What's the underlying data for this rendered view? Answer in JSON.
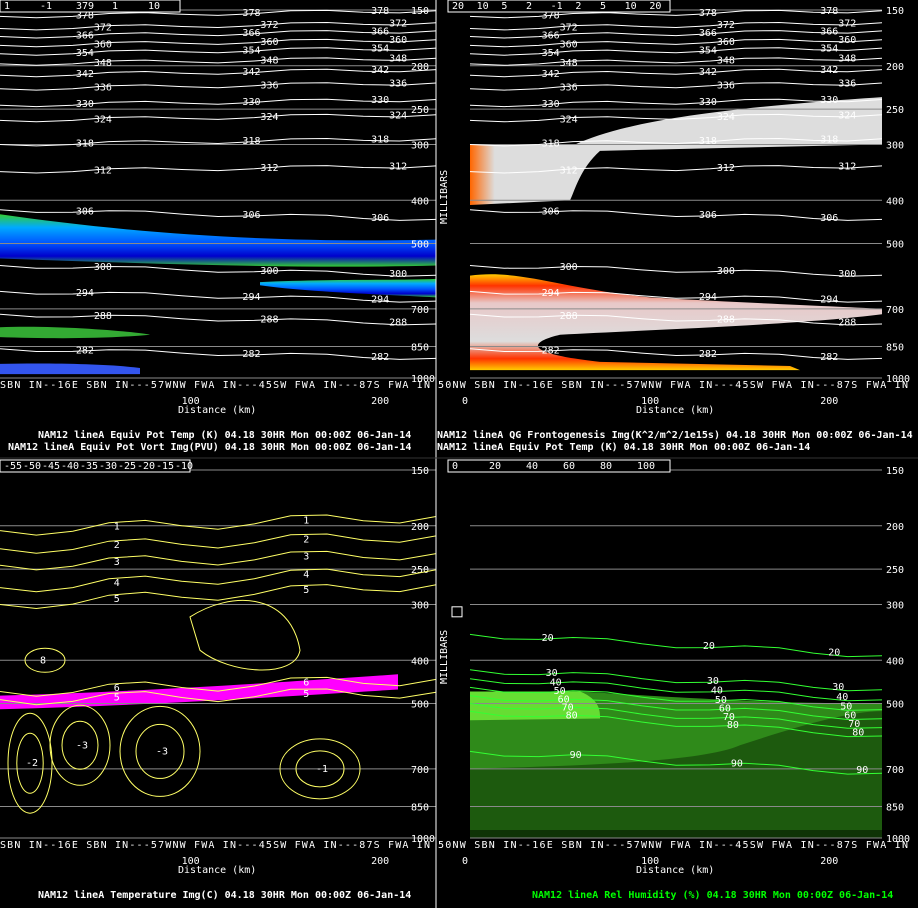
{
  "colors": {
    "background": "#000000",
    "grid": "#ffffff",
    "theta_contour": "#ffffff",
    "temperature_contour": "#ffff66",
    "rh_contour": "#33ff33",
    "pv_fill": [
      "#33cc33",
      "#00aaff",
      "#0055ff",
      "#0000cc"
    ],
    "frontogenesis_fill": [
      "#ffff00",
      "#ff9900",
      "#ff2200",
      "#cc0000",
      "#ffcccc",
      "#dddddd"
    ],
    "rh_fill": [
      "#66dd33",
      "#44aa22",
      "#227711",
      "#114400"
    ],
    "temp_highlight": "#ff00ff",
    "caption_white": "#ffffff",
    "caption_green": "#00ff00"
  },
  "panels": [
    {
      "id": "top-left",
      "legend": [
        "1",
        "-1",
        "379",
        "1",
        "10"
      ],
      "pressure_ticks": [
        "150",
        "200",
        "250",
        "300",
        "400",
        "500",
        "700",
        "850",
        "1000"
      ],
      "x_ticks": [
        "100",
        "200"
      ],
      "x_label": "Distance (km)",
      "stations": "SBN IN--16E SBN IN---57WNW FWA IN---45SW FWA IN---87S FWA IN",
      "captions": [
        {
          "text": "NAM12 lineA  Equiv Pot Temp (K)  04.18  30HR Mon 00:00Z 06-Jan-14",
          "color": "#ffffff"
        },
        {
          "text": "NAM12 lineA  Equiv Pot Vort Img(PVU)  04.18  30HR Mon 00:00Z 06-Jan-14",
          "color": "#ffffff"
        }
      ]
    },
    {
      "id": "top-right",
      "legend": [
        "20",
        "10",
        "5",
        "2",
        "-1",
        "2",
        "5",
        "10",
        "20"
      ],
      "y_label": "MILLIBARS",
      "pressure_ticks": [
        "150",
        "200",
        "250",
        "300",
        "400",
        "500",
        "700",
        "850",
        "1000"
      ],
      "x_ticks": [
        "0",
        "100",
        "200"
      ],
      "x_label": "Distance (km)",
      "stations": "50NW SBN IN--16E SBN IN---57WNW FWA IN---45SW FWA IN---87S FWA IN",
      "captions": [
        {
          "text": "NAM12 lineA  QG Frontogenesis Img(K^2/m^2/1e15s)  04.18  30HR Mon 00:00Z 06-Jan-14",
          "color": "#ffffff"
        },
        {
          "text": "NAM12 lineA  Equiv Pot Temp (K)  04.18  30HR Mon 00:00Z 06-Jan-14",
          "color": "#ffffff"
        }
      ]
    },
    {
      "id": "bottom-left",
      "legend": [
        "-55",
        "-50",
        "-45",
        "-40",
        "-35",
        "-30",
        "-25",
        "-20",
        "-15",
        "-10"
      ],
      "pressure_ticks": [
        "150",
        "200",
        "250",
        "300",
        "400",
        "500",
        "700",
        "850",
        "1000"
      ],
      "x_ticks": [
        "100",
        "200"
      ],
      "x_label": "Distance (km)",
      "stations": "SBN IN--16E SBN IN---57WNW FWA IN---45SW FWA IN---87S FWA IN",
      "captions": [
        {
          "text": "NAM12 lineA  Temperature Img(C)  04.18  30HR Mon 00:00Z 06-Jan-14",
          "color": "#ffffff"
        }
      ]
    },
    {
      "id": "bottom-right",
      "legend": [
        "0",
        "20",
        "40",
        "60",
        "80",
        "100"
      ],
      "y_label": "MILLIBARS",
      "pressure_ticks": [
        "150",
        "200",
        "250",
        "300",
        "400",
        "500",
        "700",
        "850",
        "1000"
      ],
      "x_ticks": [
        "0",
        "100",
        "200"
      ],
      "x_label": "Distance (km)",
      "stations": "50NW SBN IN--16E SBN IN---57WNW FWA IN---45SW FWA IN---87S FWA IN",
      "captions": [
        {
          "text": "NAM12 lineA  Rel Humidity (%)  04.18  30HR Mon 00:00Z 06-Jan-14",
          "color": "#00ff00"
        }
      ]
    }
  ],
  "chart_data": [
    {
      "type": "heatmap",
      "panel": "top-left",
      "xlabel": "Distance (km)",
      "ylabel": "",
      "xlim": [
        0,
        230
      ],
      "ylim": [
        1000,
        150
      ],
      "y_scale": "log-pressure",
      "grid": true,
      "contours": [
        {
          "label": "378",
          "p": 155
        },
        {
          "label": "372",
          "p": 165
        },
        {
          "label": "366",
          "p": 172
        },
        {
          "label": "360",
          "p": 180
        },
        {
          "label": "354",
          "p": 188
        },
        {
          "label": "348",
          "p": 198
        },
        {
          "label": "342",
          "p": 210
        },
        {
          "label": "336",
          "p": 225
        },
        {
          "label": "330",
          "p": 245
        },
        {
          "label": "324",
          "p": 265
        },
        {
          "label": "318",
          "p": 300
        },
        {
          "label": "312",
          "p": 345
        },
        {
          "label": "306",
          "p": 420
        },
        {
          "label": "300",
          "p": 560
        },
        {
          "label": "294",
          "p": 640
        },
        {
          "label": "288",
          "p": 720
        },
        {
          "label": "282",
          "p": 860
        }
      ]
    },
    {
      "type": "heatmap",
      "panel": "top-right",
      "xlabel": "Distance (km)",
      "ylabel": "MILLIBARS",
      "xlim": [
        0,
        230
      ],
      "ylim": [
        1000,
        150
      ],
      "y_scale": "log-pressure",
      "grid": true,
      "contours": [
        {
          "label": "378",
          "p": 155
        },
        {
          "label": "372",
          "p": 165
        },
        {
          "label": "366",
          "p": 172
        },
        {
          "label": "360",
          "p": 180
        },
        {
          "label": "354",
          "p": 188
        },
        {
          "label": "348",
          "p": 198
        },
        {
          "label": "342",
          "p": 210
        },
        {
          "label": "336",
          "p": 225
        },
        {
          "label": "330",
          "p": 245
        },
        {
          "label": "324",
          "p": 265
        },
        {
          "label": "318",
          "p": 300
        },
        {
          "label": "312",
          "p": 345
        },
        {
          "label": "306",
          "p": 420
        },
        {
          "label": "300",
          "p": 560
        },
        {
          "label": "294",
          "p": 640
        },
        {
          "label": "288",
          "p": 720
        },
        {
          "label": "282",
          "p": 860
        }
      ]
    },
    {
      "type": "heatmap",
      "panel": "bottom-left",
      "xlabel": "Distance (km)",
      "ylabel": "",
      "xlim": [
        0,
        230
      ],
      "ylim": [
        1000,
        150
      ],
      "y_scale": "log-pressure",
      "grid": true,
      "contour_labels": [
        "1",
        "2",
        "3",
        "4",
        "5",
        "6",
        "8",
        "-1",
        "-2",
        "-3"
      ]
    },
    {
      "type": "heatmap",
      "panel": "bottom-right",
      "xlabel": "Distance (km)",
      "ylabel": "MILLIBARS",
      "xlim": [
        0,
        230
      ],
      "ylim": [
        1000,
        150
      ],
      "y_scale": "log-pressure",
      "grid": true,
      "contours": [
        {
          "label": "20",
          "p": 350
        },
        {
          "label": "30",
          "p": 420
        },
        {
          "label": "40",
          "p": 440
        },
        {
          "label": "50",
          "p": 460
        },
        {
          "label": "60",
          "p": 480
        },
        {
          "label": "70",
          "p": 500
        },
        {
          "label": "80",
          "p": 520
        },
        {
          "label": "90",
          "p": 640
        }
      ]
    }
  ]
}
